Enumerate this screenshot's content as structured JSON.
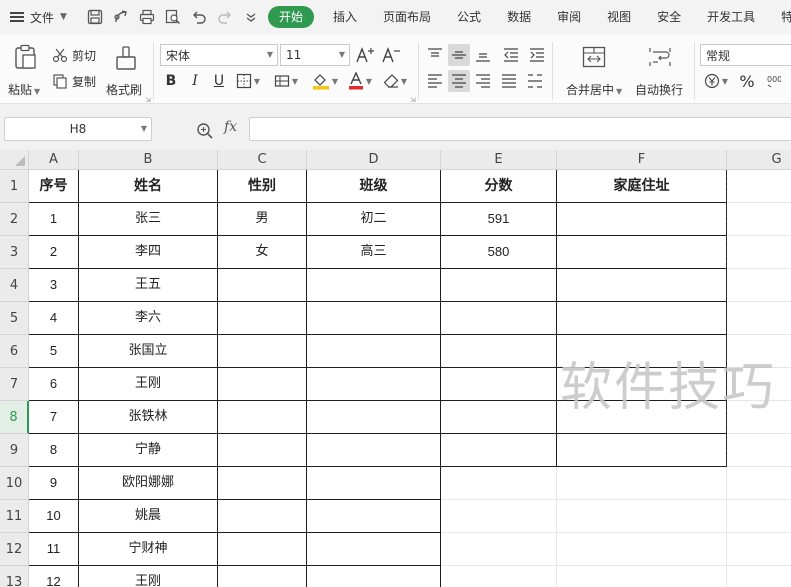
{
  "menubar": {
    "file_label": "文件",
    "tabs": [
      "开始",
      "插入",
      "页面布局",
      "公式",
      "数据",
      "审阅",
      "视图",
      "安全",
      "开发工具",
      "特色"
    ]
  },
  "ribbon": {
    "paste_label": "粘贴",
    "cut_label": "剪切",
    "copy_label": "复制",
    "format_painter_label": "格式刷",
    "font_name": "宋体",
    "font_size": "11",
    "merge_center_label": "合并居中",
    "wrap_text_label": "自动换行",
    "number_format": "常规",
    "percent_symbol": "%"
  },
  "formula_bar": {
    "name_box": "H8",
    "fx_label": "fx",
    "formula": ""
  },
  "sheet": {
    "col_headers": [
      "A",
      "B",
      "C",
      "D",
      "E",
      "F",
      "G"
    ],
    "row_headers": [
      "1",
      "2",
      "3",
      "4",
      "5",
      "6",
      "7",
      "8",
      "9",
      "10",
      "11",
      "12",
      "13"
    ],
    "active_row": "8",
    "header_row": [
      "序号",
      "姓名",
      "性别",
      "班级",
      "分数",
      "家庭住址"
    ],
    "rows": [
      [
        "1",
        "张三",
        "男",
        "初二",
        "591",
        ""
      ],
      [
        "2",
        "李四",
        "女",
        "高三",
        "580",
        ""
      ],
      [
        "3",
        "王五",
        "",
        "",
        "",
        ""
      ],
      [
        "4",
        "李六",
        "",
        "",
        "",
        ""
      ],
      [
        "5",
        "张国立",
        "",
        "",
        "",
        ""
      ],
      [
        "6",
        "王刚",
        "",
        "",
        "",
        ""
      ],
      [
        "7",
        "张铁林",
        "",
        "",
        "",
        ""
      ],
      [
        "8",
        "宁静",
        "",
        "",
        "",
        ""
      ],
      [
        "9",
        "欧阳娜娜",
        "",
        "",
        "",
        ""
      ],
      [
        "10",
        "姚晨",
        "",
        "",
        "",
        ""
      ],
      [
        "11",
        "宁财神",
        "",
        "",
        "",
        ""
      ],
      [
        "12",
        "王刚",
        "",
        "",
        "",
        ""
      ]
    ]
  },
  "watermark": "软件技巧",
  "colors": {
    "accent": "#2f9a4f"
  }
}
